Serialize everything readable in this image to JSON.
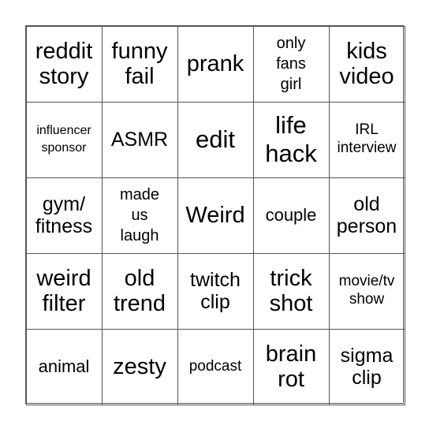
{
  "board": {
    "cells": [
      "reddit story",
      "funny fail",
      "prank",
      "only fans girl",
      "kids video",
      "influencer sponsor",
      "ASMR",
      "edit",
      "life hack",
      "IRL interview",
      "gym/ fitness",
      "made us laugh",
      "Weird",
      "couple",
      "old person",
      "weird filter",
      "old trend",
      "twitch clip",
      "trick shot",
      "movie/tv show",
      "animal",
      "zesty",
      "podcast",
      "brain rot",
      "sigma clip"
    ],
    "lines": [
      [
        "reddit",
        "story"
      ],
      [
        "funny",
        "fail"
      ],
      [
        "prank"
      ],
      [
        "only",
        "fans",
        "girl"
      ],
      [
        "kids",
        "video"
      ],
      [
        "influencer",
        "sponsor"
      ],
      [
        "ASMR"
      ],
      [
        "edit"
      ],
      [
        "life",
        "hack"
      ],
      [
        "IRL",
        "interview"
      ],
      [
        "gym/",
        "fitness"
      ],
      [
        "made",
        "us",
        "laugh"
      ],
      [
        "Weird"
      ],
      [
        "couple"
      ],
      [
        "old",
        "person"
      ],
      [
        "weird",
        "filter"
      ],
      [
        "old",
        "trend"
      ],
      [
        "twitch",
        "clip"
      ],
      [
        "trick",
        "shot"
      ],
      [
        "movie/tv",
        "show"
      ],
      [
        "animal"
      ],
      [
        "zesty"
      ],
      [
        "podcast"
      ],
      [
        "brain",
        "rot"
      ],
      [
        "sigma",
        "clip"
      ]
    ]
  }
}
